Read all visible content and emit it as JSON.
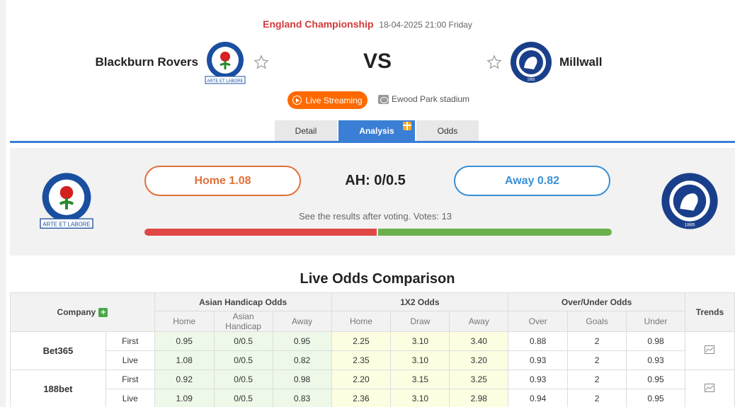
{
  "match": {
    "league": "England Championship",
    "datetime": "18-04-2025 21:00 Friday",
    "home": "Blackburn Rovers",
    "away": "Millwall",
    "vs": "VS",
    "live_label": "Live Streaming",
    "stadium": "Ewood Park stadium",
    "home_crest_motto": "ARTE ET LABORE",
    "away_crest_year": "1885"
  },
  "tabs": [
    "Detail",
    "Analysis",
    "Odds"
  ],
  "vote": {
    "home_label": "Home 1.08",
    "away_label": "Away 0.82",
    "ah_label": "AH: 0/0.5",
    "text": "See the results after voting. Votes: 13",
    "home_share": 0.5,
    "away_share": 0.5
  },
  "section_title": "Live Odds Comparison",
  "table": {
    "company_header": "Company",
    "groups": [
      "Asian Handicap Odds",
      "1X2 Odds",
      "Over/Under Odds"
    ],
    "trends_header": "Trends",
    "subheaders": [
      "Home",
      "Asian Handicap",
      "Away",
      "Home",
      "Draw",
      "Away",
      "Over",
      "Goals",
      "Under"
    ],
    "companies": [
      {
        "name": "Bet365",
        "rows": [
          {
            "type": "First",
            "values": [
              "0.95",
              "0/0.5",
              "0.95",
              "2.25",
              "3.10",
              "3.40",
              "0.88",
              "2",
              "0.98"
            ]
          },
          {
            "type": "Live",
            "values": [
              "1.08",
              "0/0.5",
              "0.82",
              "2.35",
              "3.10",
              "3.20",
              "0.93",
              "2",
              "0.93"
            ]
          }
        ]
      },
      {
        "name": "188bet",
        "rows": [
          {
            "type": "First",
            "values": [
              "0.92",
              "0/0.5",
              "0.98",
              "2.20",
              "3.15",
              "3.25",
              "0.93",
              "2",
              "0.95"
            ]
          },
          {
            "type": "Live",
            "values": [
              "1.09",
              "0/0.5",
              "0.83",
              "2.36",
              "3.10",
              "2.98",
              "0.94",
              "2",
              "0.95"
            ]
          }
        ]
      }
    ]
  },
  "colors": {
    "league": "#d33a3a",
    "live": "#ff6a00",
    "accent": "#3a7fd5",
    "home_vote": "#e0703a",
    "away_vote": "#3a90d5",
    "home_bar": "#e04848",
    "away_bar": "#6ab04c"
  }
}
